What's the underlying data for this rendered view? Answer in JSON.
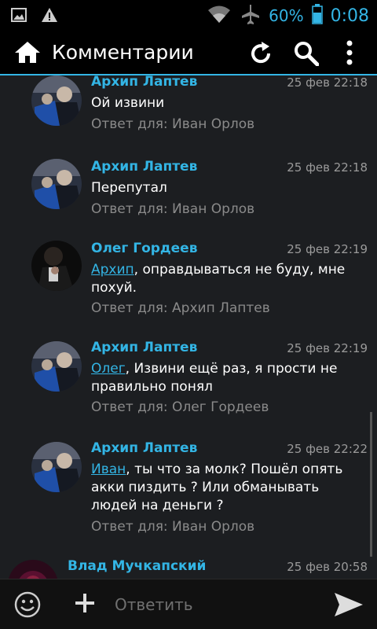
{
  "statusbar": {
    "battery_pct": "60%",
    "time": "0:08"
  },
  "actionbar": {
    "title": "Комментарии"
  },
  "comments": [
    {
      "author": "Архип Лаптев",
      "date": "25 фев 22:18",
      "text": "Ой извини",
      "reply": "Ответ для: Иван Орлов",
      "avatar": "arkhip"
    },
    {
      "author": "Архип Лаптев",
      "date": "25 фев 22:18",
      "text": "Перепутал",
      "reply": "Ответ для: Иван Орлов",
      "avatar": "arkhip"
    },
    {
      "author": "Олег Гордеев",
      "date": "25 фев 22:19",
      "mention": "Архип",
      "text": ", оправдываться не буду, мне похуй.",
      "reply": "Ответ для: Архип Лаптев",
      "avatar": "oleg"
    },
    {
      "author": "Архип Лаптев",
      "date": "25 фев 22:19",
      "mention": "Олег",
      "text": ", Извини ещё раз, я прости не правильно понял",
      "reply": "Ответ для: Олег Гордеев",
      "avatar": "arkhip"
    },
    {
      "author": "Архип Лаптев",
      "date": "25 фев 22:22",
      "mention": "Иван",
      "text": ", ты что за молк? Пошёл опять акки пиздить ? Или обманывать людей на деньги ?",
      "reply": "Ответ для: Иван Орлов",
      "avatar": "arkhip"
    },
    {
      "author": "Влад Мучкапский",
      "date": "25 фев 20:58",
      "avatar": "vlad"
    }
  ],
  "inputbar": {
    "placeholder": "Ответить"
  },
  "colors": {
    "accent": "#33b5e5",
    "background": "#1c1e21"
  }
}
